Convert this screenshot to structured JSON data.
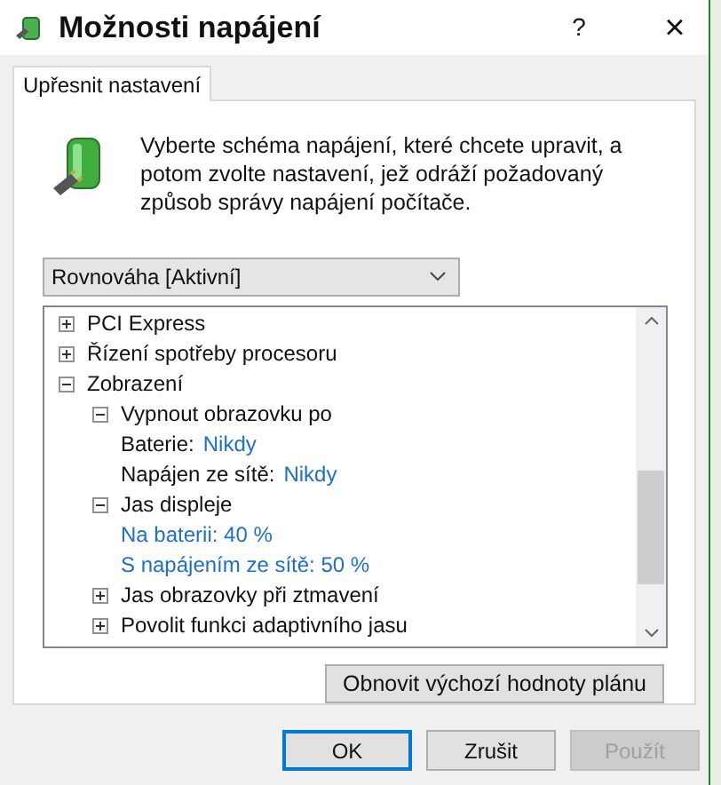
{
  "window": {
    "title": "Možnosti napájení",
    "help": "?",
    "close": "×"
  },
  "tabs": [
    {
      "label": "Upřesnit nastavení",
      "selected": true
    }
  ],
  "description": "Vyberte schéma napájení, které chcete upravit, a potom zvolte nastavení, jež odráží požadovaný způsob správy napájení počítače.",
  "plan_select": {
    "value": "Rovnováha [Aktivní]"
  },
  "tree": [
    {
      "kind": "group",
      "label": "PCI Express",
      "expanded": false
    },
    {
      "kind": "group",
      "label": "Řízení spotřeby procesoru",
      "expanded": false
    },
    {
      "kind": "group",
      "label": "Zobrazení",
      "expanded": true,
      "children": [
        {
          "kind": "group",
          "label": "Vypnout obrazovku po",
          "expanded": true,
          "children": [
            {
              "kind": "setting",
              "label": "Baterie:",
              "value": "Nikdy"
            },
            {
              "kind": "setting",
              "label": "Napájen ze sítě:",
              "value": "Nikdy"
            }
          ]
        },
        {
          "kind": "group",
          "label": "Jas displeje",
          "expanded": true,
          "children": [
            {
              "kind": "link",
              "value": "Na baterii: 40 %"
            },
            {
              "kind": "link",
              "value": "S napájením ze sítě: 50 %"
            }
          ]
        },
        {
          "kind": "group",
          "label": "Jas obrazovky při ztmavení",
          "expanded": false
        },
        {
          "kind": "group",
          "label": "Povolit funkci adaptivního jasu",
          "expanded": false
        }
      ]
    }
  ],
  "restore_button": "Obnovit výchozí hodnoty plánu",
  "buttons": [
    {
      "label": "OK",
      "default": true,
      "disabled": false
    },
    {
      "label": "Zrušit",
      "default": false,
      "disabled": false
    },
    {
      "label": "Použít",
      "default": false,
      "disabled": true
    }
  ]
}
